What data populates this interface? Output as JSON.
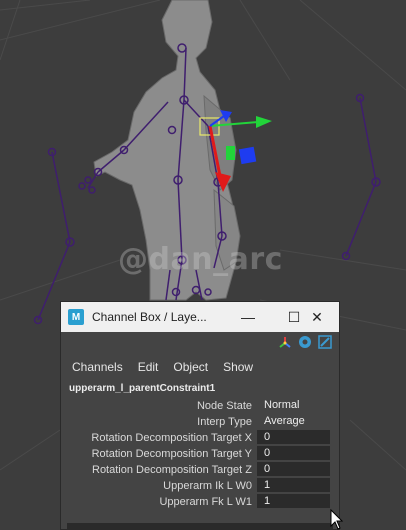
{
  "watermark": "@dan_arc",
  "channel_box": {
    "title": "Channel Box / Laye...",
    "logo_letter": "M",
    "window_buttons": {
      "minimize": "—",
      "maximize": "☐",
      "close": "✕"
    },
    "menus": [
      "Channels",
      "Edit",
      "Object",
      "Show"
    ],
    "node_name": "upperarm_l_parentConstraint1",
    "attributes": [
      {
        "label": "Node State",
        "value": "Normal",
        "field": false
      },
      {
        "label": "Interp Type",
        "value": "Average",
        "field": false
      },
      {
        "label": "Rotation Decomposition Target X",
        "value": "0",
        "field": true
      },
      {
        "label": "Rotation Decomposition Target Y",
        "value": "0",
        "field": true
      },
      {
        "label": "Rotation Decomposition Target Z",
        "value": "0",
        "field": true
      },
      {
        "label": "Upperarm Ik L W0",
        "value": "1",
        "field": true
      },
      {
        "label": "Upperarm Fk L W1",
        "value": "1",
        "field": true
      }
    ]
  },
  "icons": [
    "maya-logo-icon",
    "minimize-icon",
    "maximize-icon",
    "close-icon",
    "channel-box-icon",
    "attribute-editor-icon",
    "tool-settings-icon",
    "mouse-cursor-icon"
  ],
  "colors": {
    "viewport_bg": "#3d3d3d",
    "panel_bg": "#444444",
    "titlebar_bg": "#f0f0f0",
    "joint_color": "#3f1e6e",
    "manip_x": "#e01a1a",
    "manip_y": "#22d43a",
    "manip_z": "#1e3cf0"
  }
}
